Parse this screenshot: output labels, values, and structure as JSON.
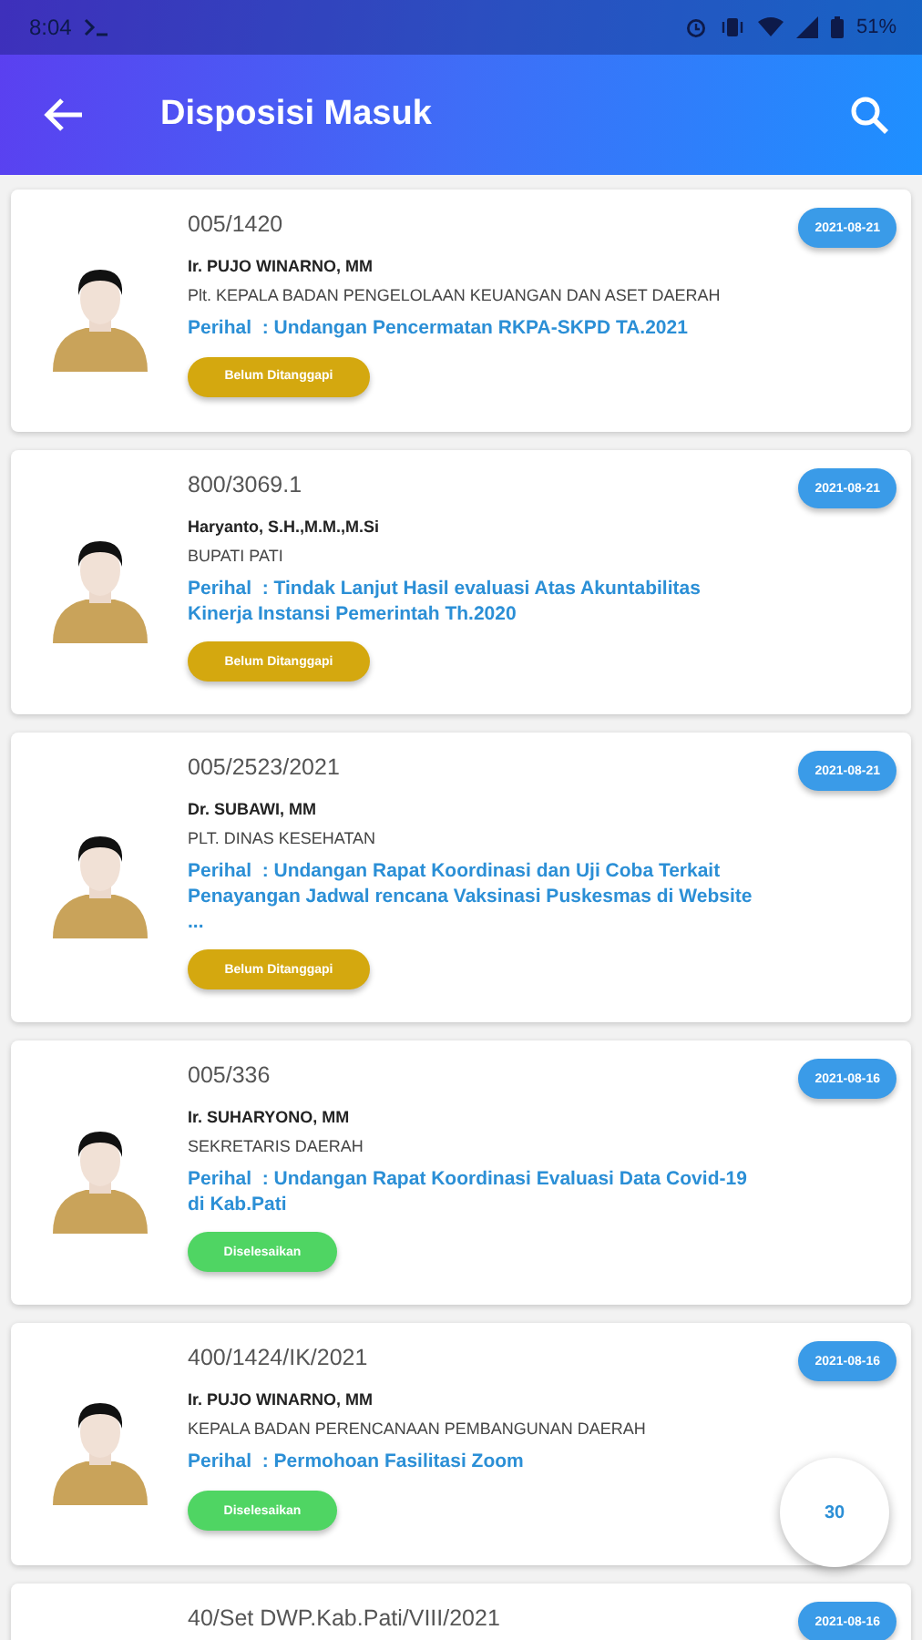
{
  "status_bar": {
    "time": "8:04",
    "battery": "51%"
  },
  "app_bar": {
    "title": "Disposisi Masuk"
  },
  "items": [
    {
      "number": "005/1420",
      "date": "2021-08-21",
      "name": "Ir. PUJO WINARNO, MM",
      "position": "Plt. KEPALA BADAN PENGELOLAAN KEUANGAN DAN ASET DAERAH",
      "subject": "Perihal  : Undangan Pencermatan RKPA-SKPD TA.2021",
      "status": {
        "label": "Belum Ditanggapi",
        "kind": "pending"
      }
    },
    {
      "number": "800/3069.1",
      "date": "2021-08-21",
      "name": "Haryanto, S.H.,M.M.,M.Si",
      "position": "BUPATI PATI",
      "subject": "Perihal  : Tindak Lanjut Hasil evaluasi Atas Akuntabilitas Kinerja Instansi Pemerintah Th.2020",
      "status": {
        "label": "Belum Ditanggapi",
        "kind": "pending"
      }
    },
    {
      "number": "005/2523/2021",
      "date": "2021-08-21",
      "name": "Dr. SUBAWI, MM",
      "position": "PLT. DINAS KESEHATAN",
      "subject": "Perihal  : Undangan Rapat Koordinasi dan Uji Coba Terkait Penayangan Jadwal rencana Vaksinasi Puskesmas di Website ...",
      "status": {
        "label": "Belum Ditanggapi",
        "kind": "pending"
      }
    },
    {
      "number": "005/336",
      "date": "2021-08-16",
      "name": "Ir. SUHARYONO, MM",
      "position": "SEKRETARIS DAERAH",
      "subject": "Perihal  : Undangan Rapat Koordinasi Evaluasi Data Covid-19 di Kab.Pati",
      "status": {
        "label": "Diselesaikan",
        "kind": "done"
      }
    },
    {
      "number": "400/1424/IK/2021",
      "date": "2021-08-16",
      "name": "Ir. PUJO WINARNO, MM",
      "position": "KEPALA BADAN PERENCANAAN PEMBANGUNAN DAERAH",
      "subject": "Perihal  : Permohoan Fasilitasi Zoom",
      "status": {
        "label": "Diselesaikan",
        "kind": "done"
      }
    },
    {
      "number": "40/Set DWP.Kab.Pati/VIII/2021",
      "date": "2021-08-16"
    }
  ],
  "fab": {
    "label": "30"
  }
}
